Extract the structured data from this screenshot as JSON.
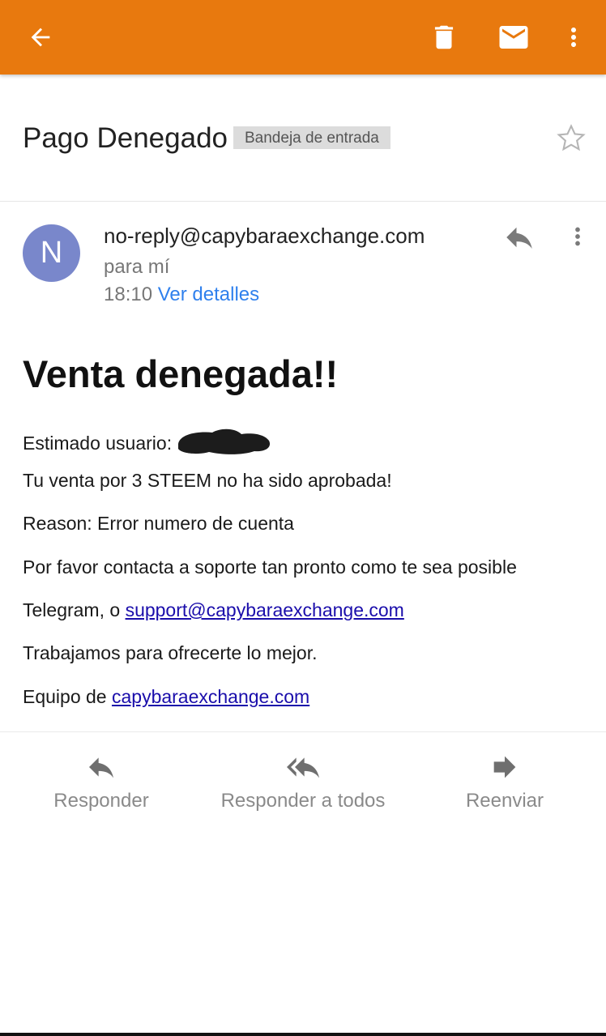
{
  "toolbar": {
    "back_icon": "arrow-back-icon",
    "delete_icon": "trash-icon",
    "mark_unread_icon": "mail-icon",
    "overflow_icon": "more-vert-icon",
    "color": "#e8790e"
  },
  "message": {
    "subject": "Pago Denegado",
    "label": "Bandeja de entrada",
    "sender_initial": "N",
    "sender": "no-reply@capybaraexchange.com",
    "recipient": "para mí",
    "time": "18:10",
    "details_link": "Ver detalles"
  },
  "email_body": {
    "title": "Venta denegada!!",
    "greeting": "Estimado usuario:",
    "line1": "Tu venta por 3 STEEM no ha sido aprobada!",
    "line2": "Reason: Error numero de cuenta",
    "line3": "Por favor contacta a soporte tan pronto como te sea posible",
    "line4_prefix": "Telegram, o ",
    "line4_link": "support@capybaraexchange.com",
    "line5": "Trabajamos para ofrecerte lo mejor.",
    "line6_prefix": "Equipo de ",
    "line6_link": "capybaraexchange.com"
  },
  "actions": {
    "reply": "Responder",
    "reply_all": "Responder a todos",
    "forward": "Reenviar"
  },
  "colors": {
    "avatar": "#7987cb",
    "link": "#2f80ed",
    "body_link": "#1a0dab"
  }
}
